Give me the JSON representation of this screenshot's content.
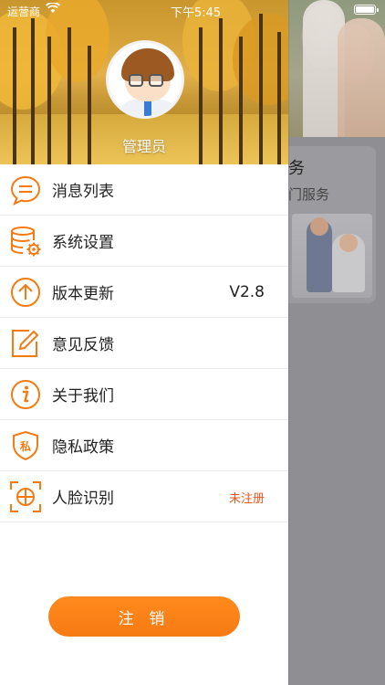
{
  "status_bar": {
    "carrier": "运营商",
    "time": "下午5:45"
  },
  "drawer": {
    "user_name": "管理员",
    "menu": [
      {
        "label": "消息列表",
        "icon": "message-icon"
      },
      {
        "label": "系统设置",
        "icon": "settings-database-icon"
      },
      {
        "label": "版本更新",
        "icon": "update-arrow-icon",
        "right_text": "V2.8"
      },
      {
        "label": "意见反馈",
        "icon": "feedback-edit-icon"
      },
      {
        "label": "关于我们",
        "icon": "info-icon"
      },
      {
        "label": "隐私政策",
        "icon": "privacy-shield-icon"
      },
      {
        "label": "人脸识别",
        "icon": "face-scan-icon",
        "right_text": "未注册"
      }
    ],
    "logout_label": "注 销"
  },
  "background_app": {
    "card_title_fragment": "务",
    "card_subtitle_fragment": "门服务"
  },
  "colors": {
    "accent": "#f67a12",
    "warning_text": "#f2541b"
  }
}
